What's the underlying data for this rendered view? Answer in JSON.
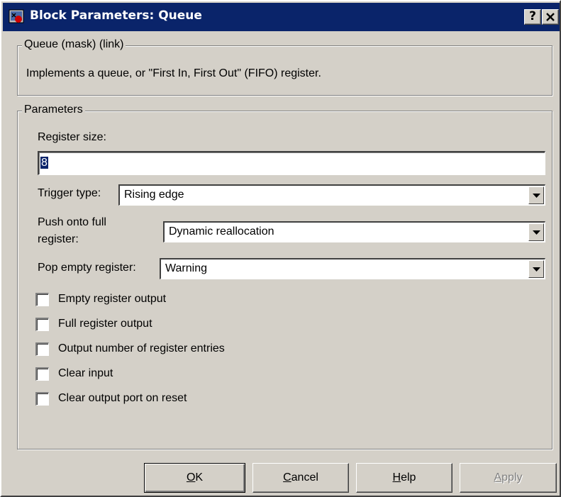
{
  "window": {
    "title": "Block Parameters: Queue",
    "help_caption": "?",
    "close_caption": "✕"
  },
  "description_group": {
    "legend": "Queue (mask) (link)",
    "text": "Implements a queue, or \"First In, First Out\" (FIFO) register."
  },
  "parameters_group": {
    "legend": "Parameters",
    "register_size": {
      "label": "Register size:",
      "value": "8"
    },
    "trigger_type": {
      "label": "Trigger type:",
      "value": "Rising edge"
    },
    "push_onto_full": {
      "label_line1": "Push onto full",
      "label_line2": "register:",
      "value": "Dynamic reallocation"
    },
    "pop_empty": {
      "label": "Pop empty register:",
      "value": "Warning"
    },
    "checkboxes": [
      {
        "label": "Empty register output",
        "checked": false
      },
      {
        "label": "Full register output",
        "checked": false
      },
      {
        "label": "Output number of register entries",
        "checked": false
      },
      {
        "label": "Clear input",
        "checked": false
      },
      {
        "label": "Clear output port on reset",
        "checked": false
      }
    ]
  },
  "buttons": {
    "ok": {
      "mnemonic": "O",
      "rest": "K"
    },
    "cancel": {
      "mnemonic": "C",
      "rest": "ancel"
    },
    "help": {
      "mnemonic": "H",
      "rest": "elp"
    },
    "apply": {
      "mnemonic": "A",
      "rest": "pply",
      "disabled": true
    }
  },
  "colors": {
    "titlebar": "#0a246a",
    "face": "#d4d0c8",
    "selection": "#0a246a"
  },
  "icons": {
    "app": "simulink-block-icon",
    "dropdown": "chevron-down-icon"
  }
}
